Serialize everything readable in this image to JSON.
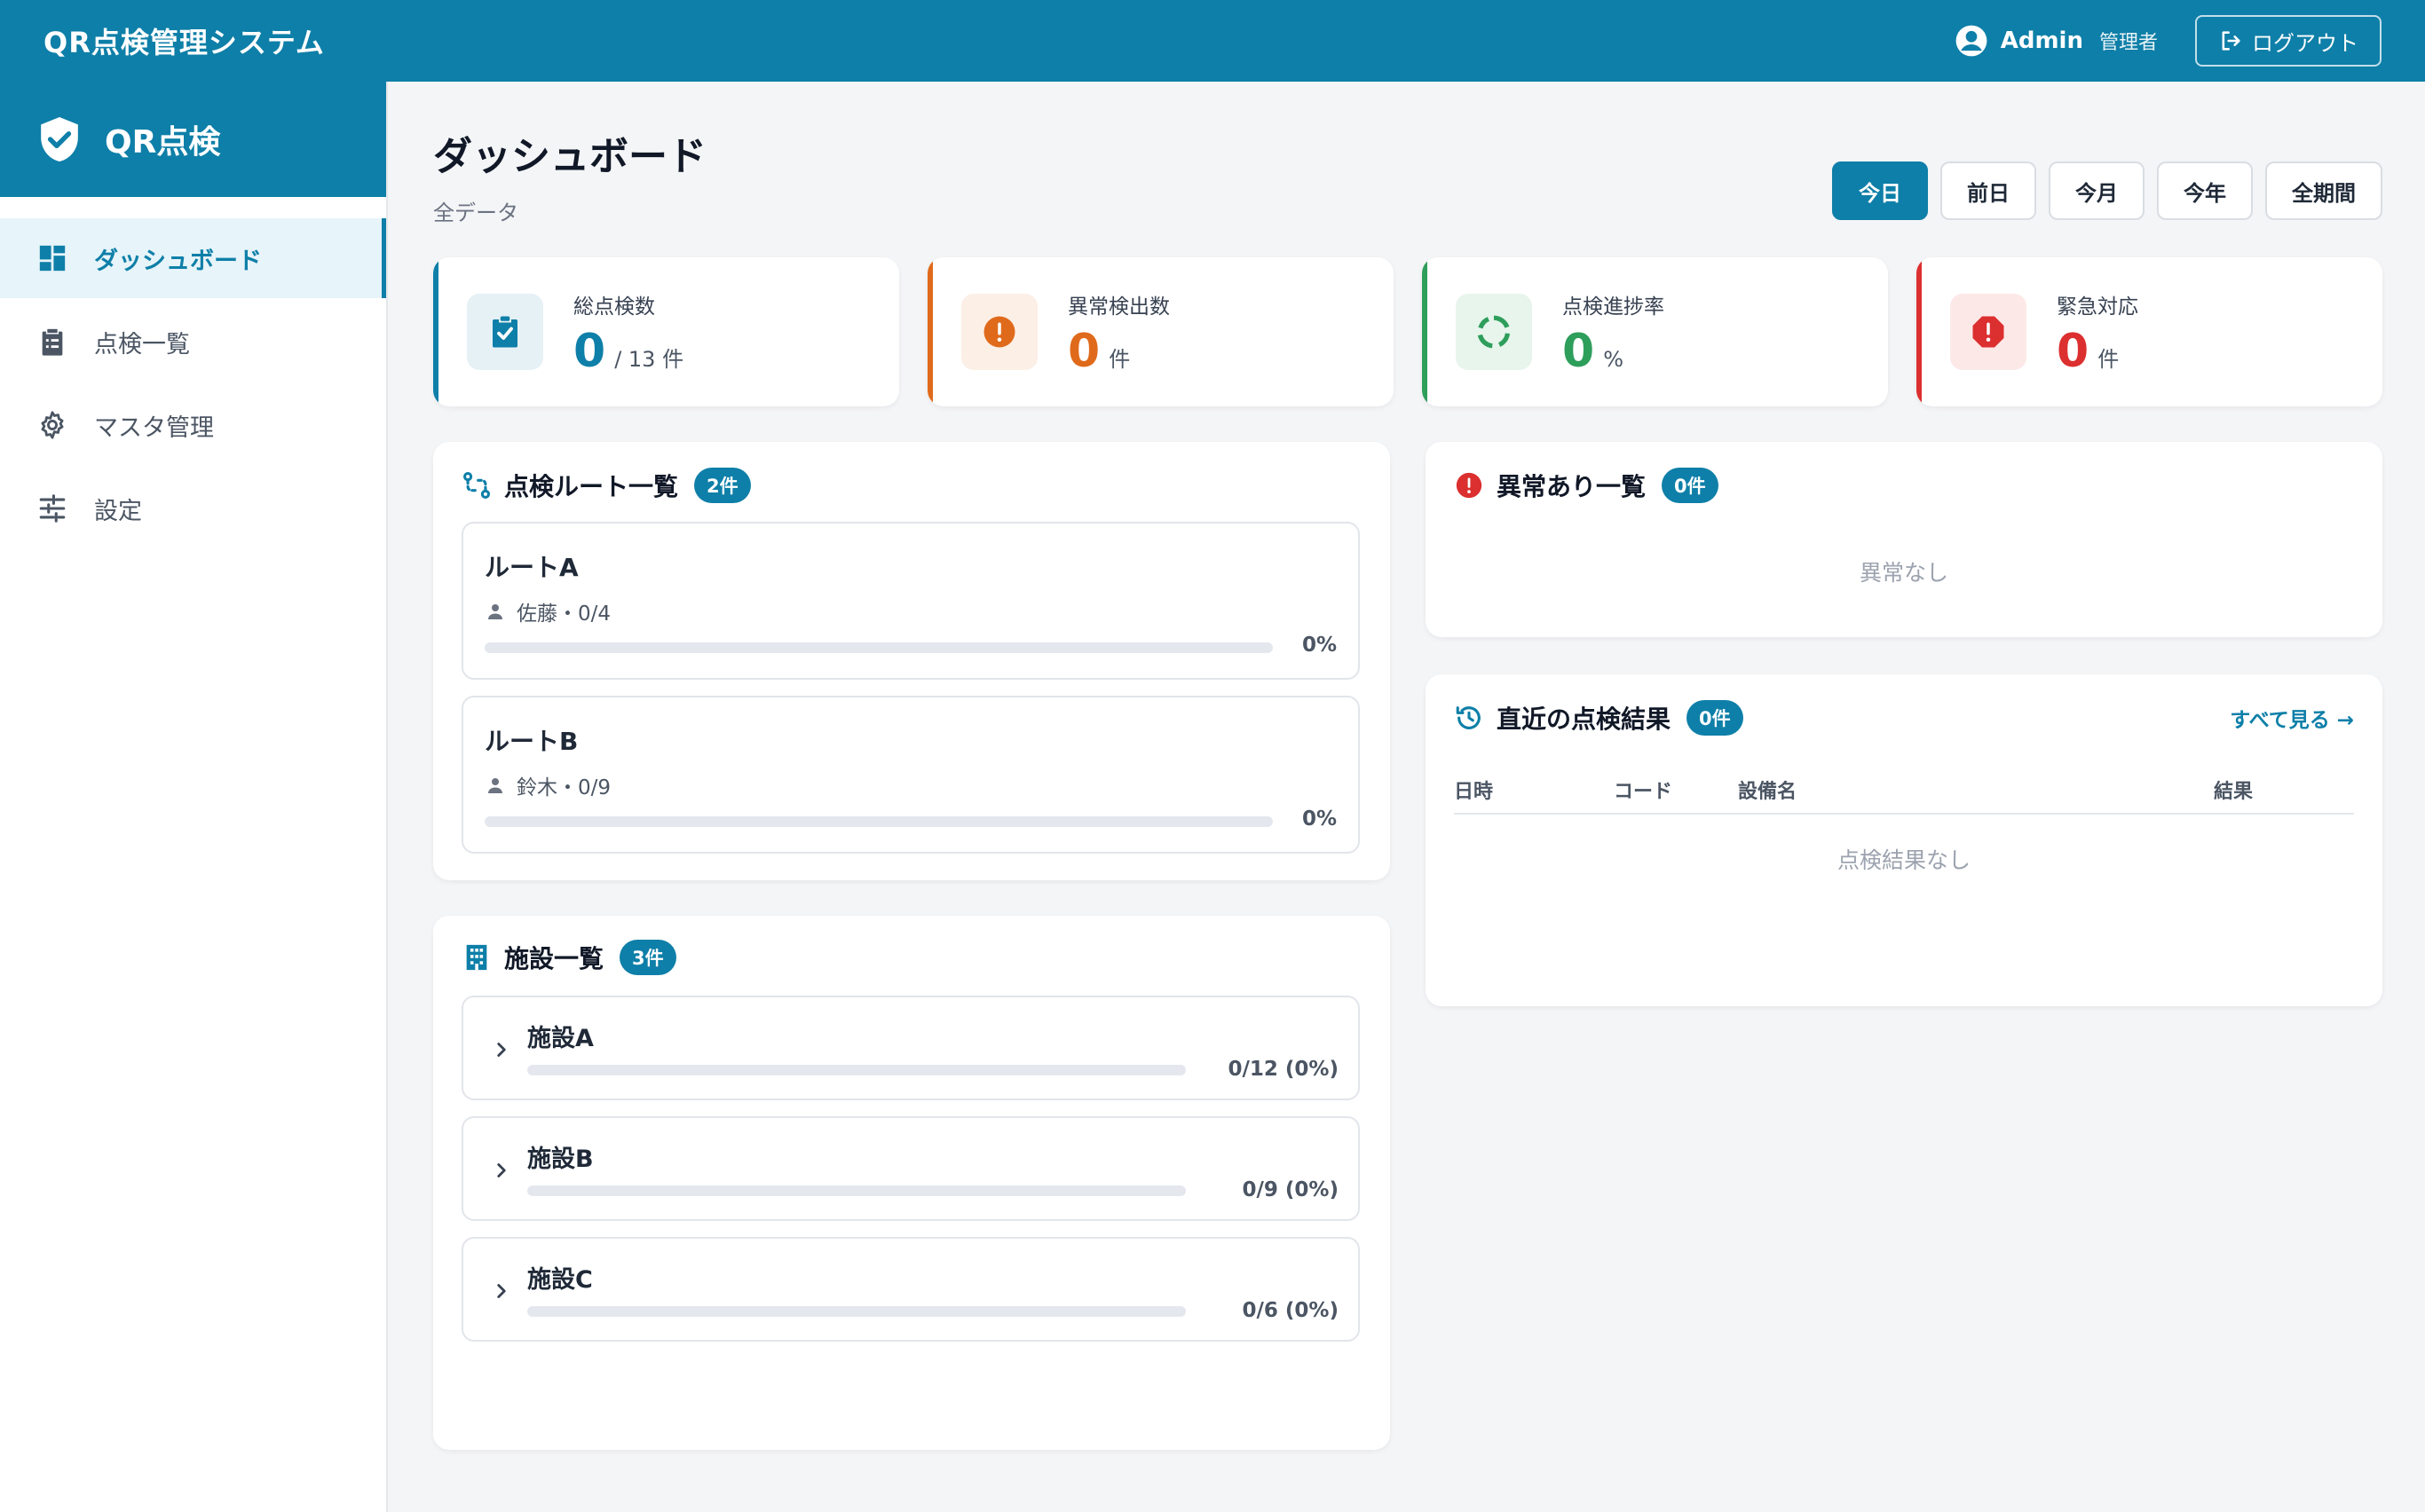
{
  "header": {
    "app_title": "QR点検管理システム",
    "user_name": "Admin",
    "user_role": "管理者",
    "logout_label": "ログアウト"
  },
  "sidebar": {
    "brand": "QR点検",
    "items": [
      {
        "label": "ダッシュボード",
        "icon": "dashboard-icon",
        "active": true
      },
      {
        "label": "点検一覧",
        "icon": "clipboard-icon",
        "active": false
      },
      {
        "label": "マスタ管理",
        "icon": "gear-icon",
        "active": false
      },
      {
        "label": "設定",
        "icon": "sliders-icon",
        "active": false
      }
    ]
  },
  "page": {
    "title": "ダッシュボード",
    "subtitle": "全データ"
  },
  "periods": [
    {
      "label": "今日",
      "active": true
    },
    {
      "label": "前日",
      "active": false
    },
    {
      "label": "今月",
      "active": false
    },
    {
      "label": "今年",
      "active": false
    },
    {
      "label": "全期間",
      "active": false
    }
  ],
  "kpis": [
    {
      "label": "総点検数",
      "value": "0",
      "unit": "/ 13 件",
      "color": "#0e7fa8",
      "icon": "clipboard-check-icon"
    },
    {
      "label": "異常検出数",
      "value": "0",
      "unit": "件",
      "color": "#e06a1b",
      "icon": "alert-circle-icon"
    },
    {
      "label": "点検進捗率",
      "value": "0",
      "unit": "%",
      "color": "#2e9e5b",
      "icon": "progress-ring-icon"
    },
    {
      "label": "緊急対応",
      "value": "0",
      "unit": "件",
      "color": "#dc2f2f",
      "icon": "alert-octagon-icon"
    }
  ],
  "routes": {
    "title": "点検ルート一覧",
    "badge": "2件",
    "items": [
      {
        "name": "ルートA",
        "meta": "佐藤・0/4",
        "percent_label": "0%",
        "progress": 0
      },
      {
        "name": "ルートB",
        "meta": "鈴木・0/9",
        "percent_label": "0%",
        "progress": 0
      }
    ]
  },
  "facilities": {
    "title": "施設一覧",
    "badge": "3件",
    "items": [
      {
        "name": "施設A",
        "stat": "0/12 (0%)",
        "progress": 0
      },
      {
        "name": "施設B",
        "stat": "0/9 (0%)",
        "progress": 0
      },
      {
        "name": "施設C",
        "stat": "0/6 (0%)",
        "progress": 0
      }
    ]
  },
  "anomalies": {
    "title": "異常あり一覧",
    "badge": "0件",
    "empty": "異常なし"
  },
  "recent": {
    "title": "直近の点検結果",
    "badge": "0件",
    "link": "すべて見る →",
    "columns": [
      "日時",
      "コード",
      "設備名",
      "結果"
    ],
    "empty": "点検結果なし"
  },
  "colors": {
    "primary": "#0e7fa8",
    "warning": "#e06a1b",
    "success": "#2e9e5b",
    "danger": "#dc2f2f"
  }
}
